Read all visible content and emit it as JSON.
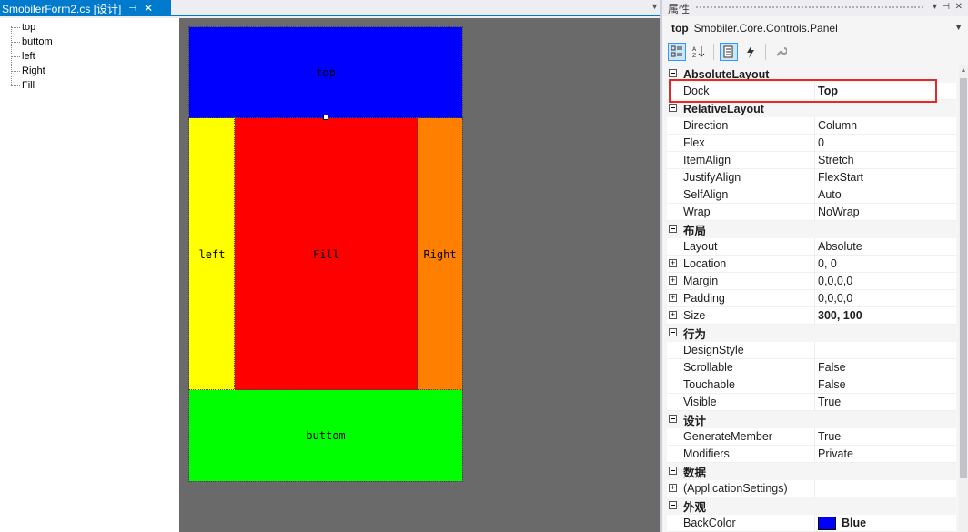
{
  "document": {
    "tab_title": "SmobilerForm2.cs [设计]",
    "tab_pin": "⊣",
    "tab_close": "✕",
    "tab_dropdown": "▼"
  },
  "tree": {
    "items": [
      {
        "label": "top"
      },
      {
        "label": "buttom"
      },
      {
        "label": "left"
      },
      {
        "label": "Right"
      },
      {
        "label": "Fill"
      }
    ]
  },
  "canvas": {
    "panels": {
      "top": {
        "label": "top",
        "color": "#0000ff"
      },
      "left": {
        "label": "left",
        "color": "#ffff00"
      },
      "fill": {
        "label": "Fill",
        "color": "#ff0000"
      },
      "right": {
        "label": "Right",
        "color": "#ff8000"
      },
      "bottom": {
        "label": "buttom",
        "color": "#00ff00"
      }
    }
  },
  "properties": {
    "title": "属性",
    "title_buttons": [
      "▾",
      "⊣",
      "✕"
    ],
    "selected_object": {
      "name": "top",
      "type": "Smobiler.Core.Controls.Panel"
    },
    "toolbar": [
      "categorized",
      "alphabetical",
      "properties",
      "events",
      "property-pages"
    ],
    "rows": [
      {
        "kind": "category",
        "name": "AbsoluteLayout"
      },
      {
        "kind": "prop",
        "name": "Dock",
        "value": "Top",
        "bold": true
      },
      {
        "kind": "category",
        "name": "RelativeLayout"
      },
      {
        "kind": "prop",
        "name": "Direction",
        "value": "Column"
      },
      {
        "kind": "prop",
        "name": "Flex",
        "value": "0"
      },
      {
        "kind": "prop",
        "name": "ItemAlign",
        "value": "Stretch"
      },
      {
        "kind": "prop",
        "name": "JustifyAlign",
        "value": "FlexStart"
      },
      {
        "kind": "prop",
        "name": "SelfAlign",
        "value": "Auto"
      },
      {
        "kind": "prop",
        "name": "Wrap",
        "value": "NoWrap"
      },
      {
        "kind": "category",
        "name": "布局"
      },
      {
        "kind": "prop",
        "name": "Layout",
        "value": "Absolute"
      },
      {
        "kind": "prop",
        "name": "Location",
        "value": "0, 0",
        "expandable": true
      },
      {
        "kind": "prop",
        "name": "Margin",
        "value": "0,0,0,0",
        "expandable": true
      },
      {
        "kind": "prop",
        "name": "Padding",
        "value": "0,0,0,0",
        "expandable": true
      },
      {
        "kind": "prop",
        "name": "Size",
        "value": "300, 100",
        "expandable": true,
        "bold": true
      },
      {
        "kind": "category",
        "name": "行为"
      },
      {
        "kind": "prop",
        "name": "DesignStyle",
        "value": ""
      },
      {
        "kind": "prop",
        "name": "Scrollable",
        "value": "False"
      },
      {
        "kind": "prop",
        "name": "Touchable",
        "value": "False"
      },
      {
        "kind": "prop",
        "name": "Visible",
        "value": "True"
      },
      {
        "kind": "category",
        "name": "设计"
      },
      {
        "kind": "prop",
        "name": "GenerateMember",
        "value": "True"
      },
      {
        "kind": "prop",
        "name": "Modifiers",
        "value": "Private"
      },
      {
        "kind": "category",
        "name": "数据"
      },
      {
        "kind": "prop",
        "name": "(ApplicationSettings)",
        "value": "",
        "expandable": true
      },
      {
        "kind": "category",
        "name": "外观"
      },
      {
        "kind": "prop",
        "name": "BackColor",
        "value": "Blue",
        "bold": true,
        "swatch": "#0000ff"
      }
    ]
  },
  "colors": {
    "accent": "#007acc",
    "highlight": "#e0292b",
    "design_surface": "#6a6a6a"
  }
}
